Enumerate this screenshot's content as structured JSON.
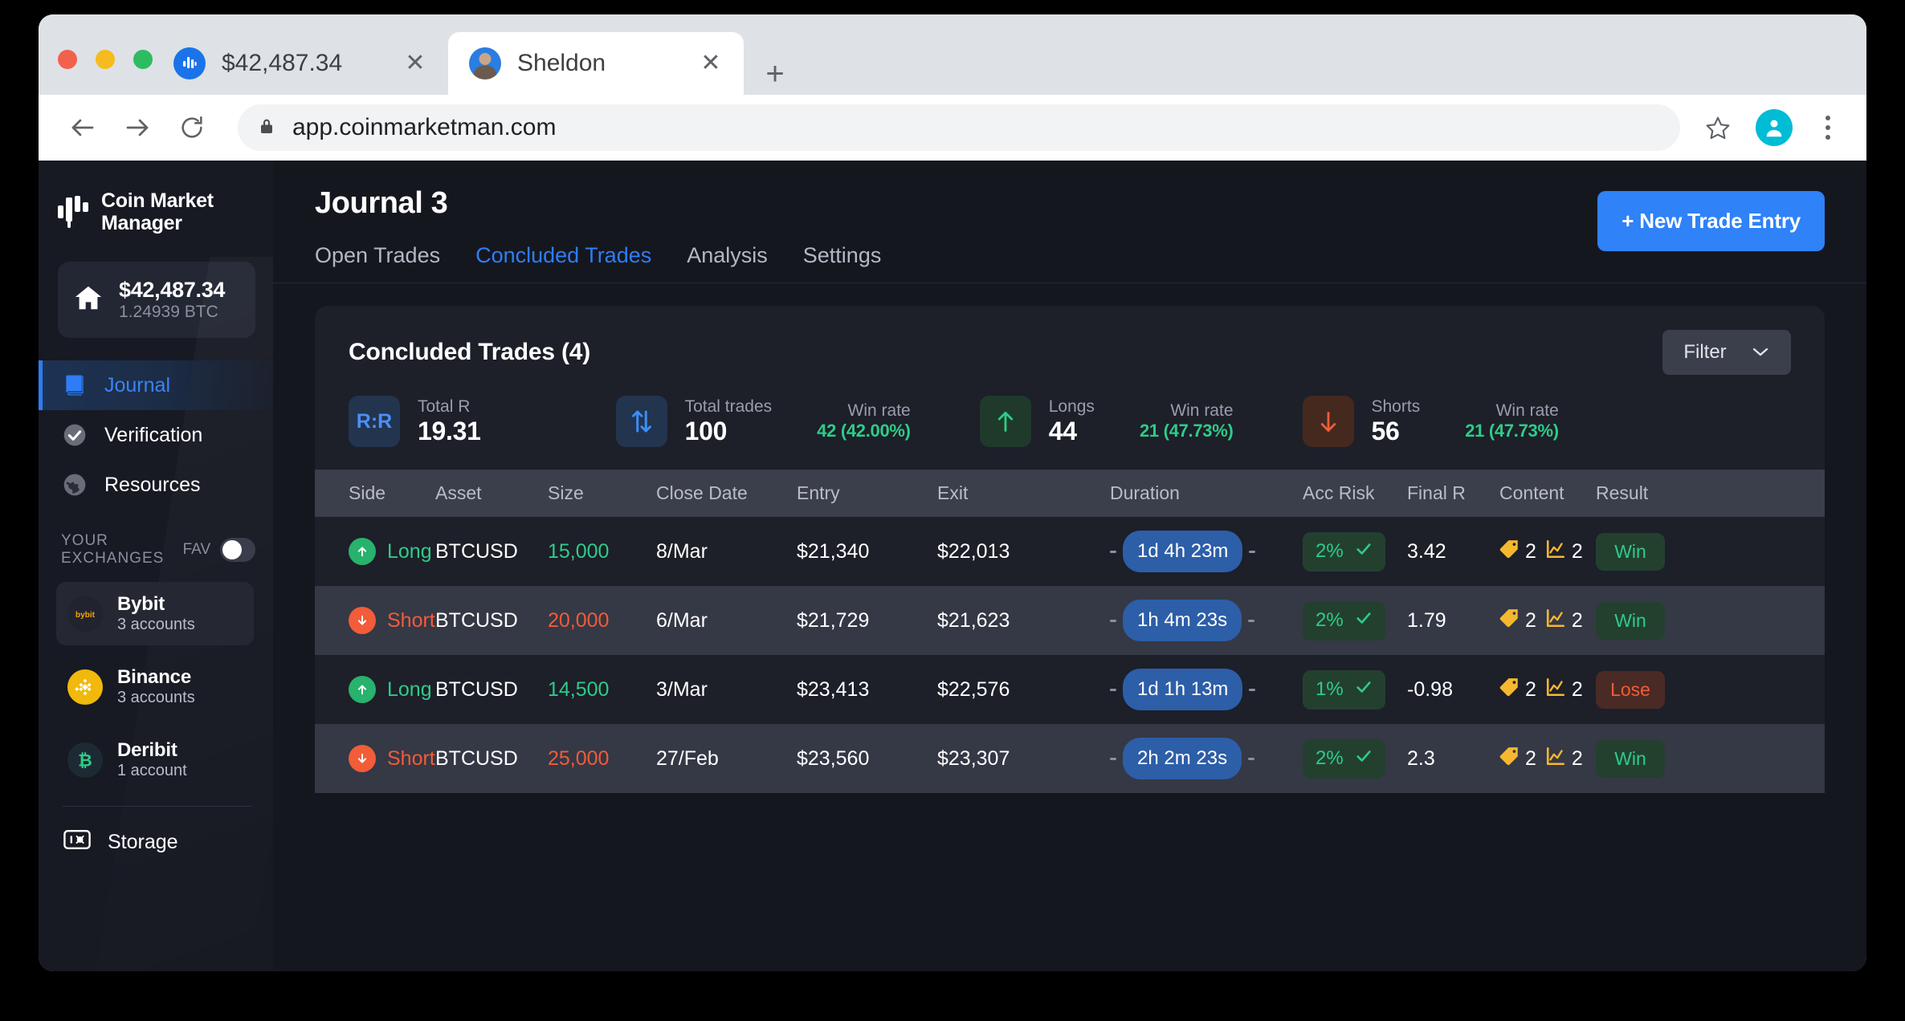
{
  "browser": {
    "tabs": [
      {
        "title": "$42,487.34",
        "favicon": "coinmarketmanager-icon",
        "close_label": "✕"
      },
      {
        "title": "Sheldon",
        "favicon": "person-avatar-icon",
        "close_label": "✕"
      }
    ],
    "new_tab_label": "+",
    "url": "app.coinmarketman.com",
    "nav": {
      "back": "back-icon",
      "forward": "forward-icon",
      "reload": "reload-icon"
    },
    "lock": "lock-icon",
    "star": "bookmark-star-icon",
    "menu": "kebab-menu-icon"
  },
  "sidebar": {
    "brand": {
      "line1": "Coin Market",
      "line2": "Manager"
    },
    "balance": {
      "fiat": "$42,487.34",
      "crypto": "1.24939 BTC"
    },
    "nav": [
      {
        "label": "Journal",
        "icon": "book-icon",
        "active": true
      },
      {
        "label": "Verification",
        "icon": "check-circle-icon",
        "active": false
      },
      {
        "label": "Resources",
        "icon": "globe-icon",
        "active": false
      }
    ],
    "exchanges_header": {
      "label": "YOUR EXCHANGES",
      "fav_label": "FAV"
    },
    "exchanges": [
      {
        "name": "Bybit",
        "accounts": "3 accounts",
        "icon": "bybit-icon",
        "selected": true
      },
      {
        "name": "Binance",
        "accounts": "3 accounts",
        "icon": "binance-icon",
        "selected": false
      },
      {
        "name": "Deribit",
        "accounts": "1 account",
        "icon": "deribit-icon",
        "selected": false
      }
    ],
    "storage": {
      "label": "Storage",
      "icon": "safe-vault-icon"
    }
  },
  "main": {
    "page_title": "Journal 3",
    "tabs": [
      {
        "label": "Open Trades",
        "active": false
      },
      {
        "label": "Concluded Trades",
        "active": true
      },
      {
        "label": "Analysis",
        "active": false
      },
      {
        "label": "Settings",
        "active": false
      }
    ],
    "new_entry_button": "+ New Trade Entry",
    "panel_title": "Concluded Trades (4)",
    "filter_label": "Filter",
    "stats": [
      {
        "icon": "rr-badge-icon",
        "label": "Total R",
        "value": "19.31",
        "winrate_label": "",
        "winrate_value": ""
      },
      {
        "icon": "arrows-updown-icon",
        "label": "Total trades",
        "value": "100",
        "winrate_label": "Win rate",
        "winrate_value": "42 (42.00%)"
      },
      {
        "icon": "arrow-up-icon",
        "label": "Longs",
        "value": "44",
        "winrate_label": "Win rate",
        "winrate_value": "21 (47.73%)"
      },
      {
        "icon": "arrow-down-icon",
        "label": "Shorts",
        "value": "56",
        "winrate_label": "Win rate",
        "winrate_value": "21 (47.73%)"
      }
    ],
    "table": {
      "columns": [
        "Side",
        "Asset",
        "Size",
        "Close Date",
        "Entry",
        "Exit",
        "Duration",
        "Acc Risk",
        "Final R",
        "Content",
        "Result"
      ],
      "rows": [
        {
          "side": "Long",
          "direction": "long",
          "asset": "BTCUSD",
          "size": "15,000",
          "close_date": "8/Mar",
          "entry": "$21,340",
          "exit": "$22,013",
          "duration": "1d 4h 23m",
          "acc_risk": "2%",
          "final_r": "3.42",
          "notes_count": "2",
          "charts_count": "2",
          "result": "Win",
          "result_kind": "win"
        },
        {
          "side": "Short",
          "direction": "short",
          "asset": "BTCUSD",
          "size": "20,000",
          "close_date": "6/Mar",
          "entry": "$21,729",
          "exit": "$21,623",
          "duration": "1h 4m 23s",
          "acc_risk": "2%",
          "final_r": "1.79",
          "notes_count": "2",
          "charts_count": "2",
          "result": "Win",
          "result_kind": "win"
        },
        {
          "side": "Long",
          "direction": "long",
          "asset": "BTCUSD",
          "size": "14,500",
          "close_date": "3/Mar",
          "entry": "$23,413",
          "exit": "$22,576",
          "duration": "1d 1h 13m",
          "acc_risk": "1%",
          "final_r": "-0.98",
          "notes_count": "2",
          "charts_count": "2",
          "result": "Lose",
          "result_kind": "lose"
        },
        {
          "side": "Short",
          "direction": "short",
          "asset": "BTCUSD",
          "size": "25,000",
          "close_date": "27/Feb",
          "entry": "$23,560",
          "exit": "$23,307",
          "duration": "2h 2m 23s",
          "acc_risk": "2%",
          "final_r": "2.3",
          "notes_count": "2",
          "charts_count": "2",
          "result": "Win",
          "result_kind": "win"
        }
      ]
    }
  },
  "colors": {
    "accent_blue": "#2f82f6",
    "green": "#2ecc87",
    "red": "#f25c38",
    "amber": "#f5b82e",
    "panel_bg": "#1d1f29",
    "app_bg": "#15171f",
    "sidebar_bg": "#171923"
  }
}
